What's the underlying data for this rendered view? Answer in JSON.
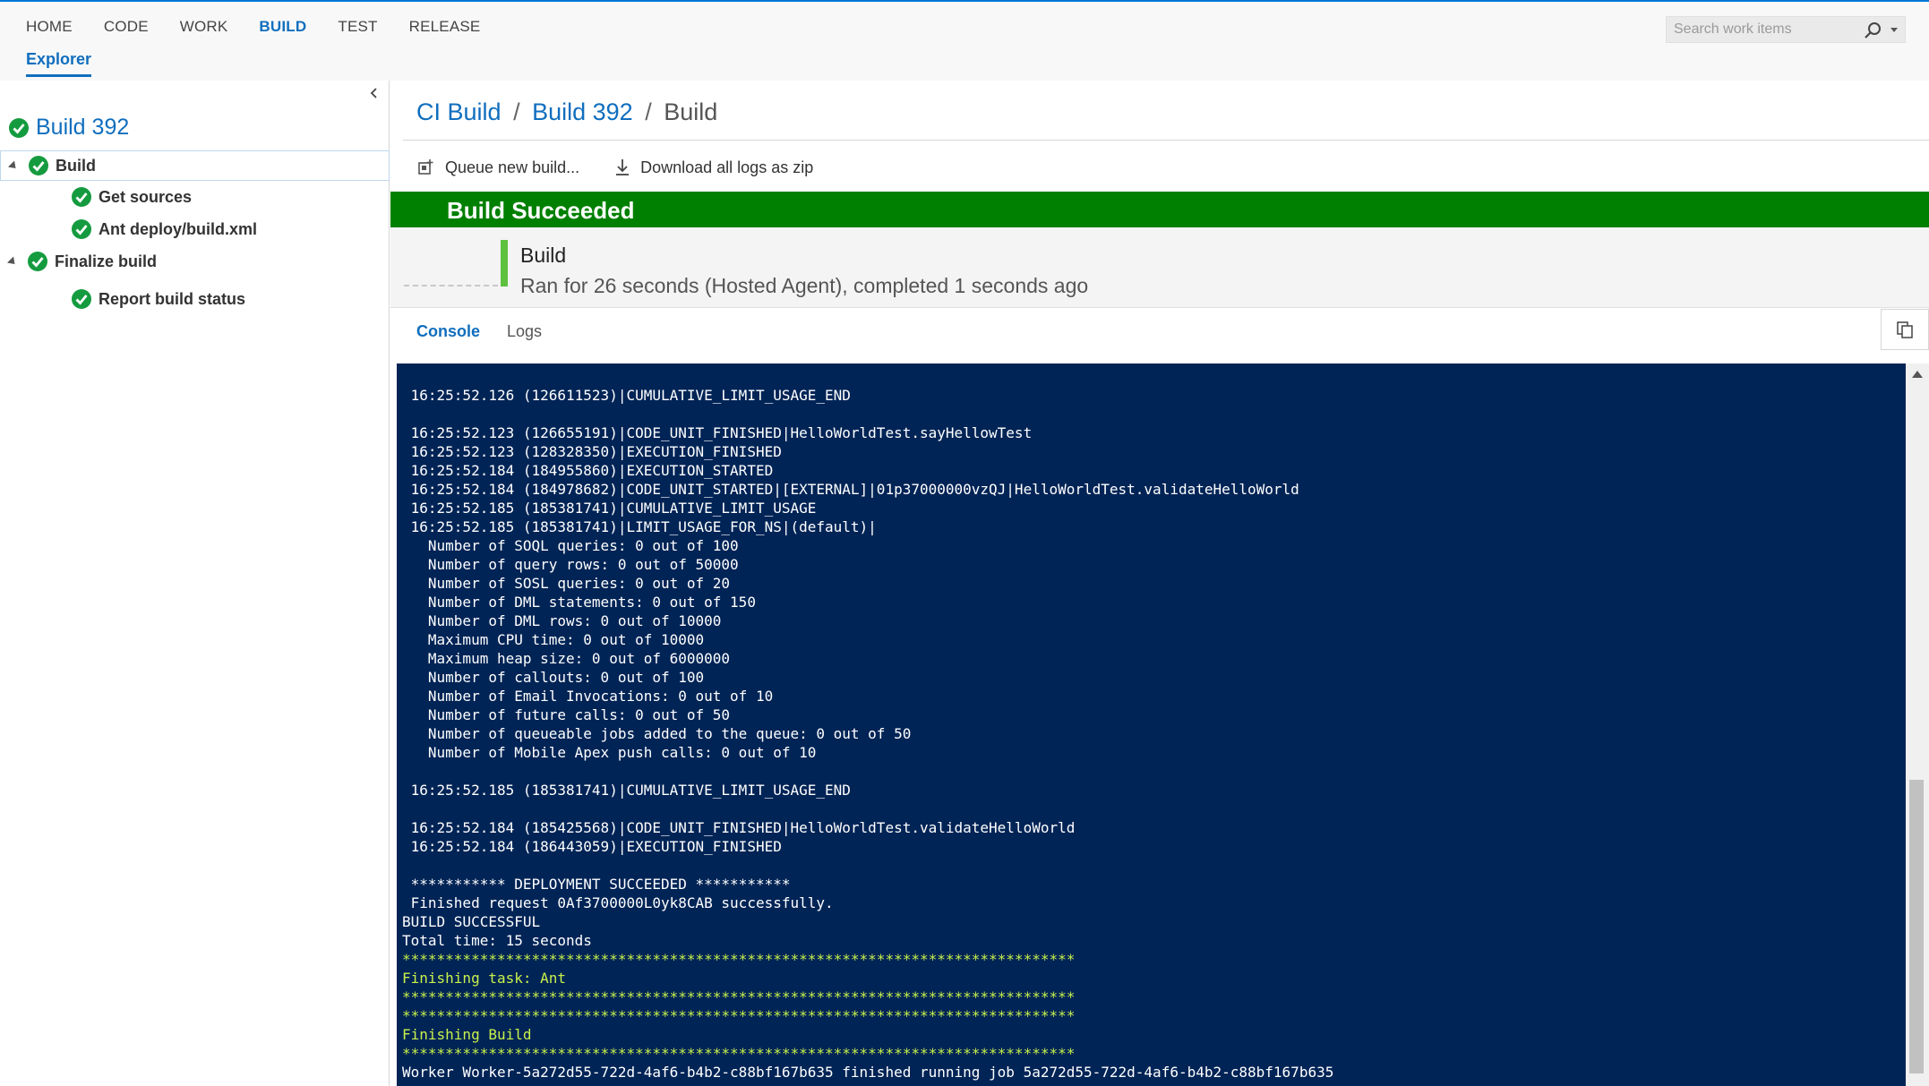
{
  "topnav": {
    "items": [
      "HOME",
      "CODE",
      "WORK",
      "BUILD",
      "TEST",
      "RELEASE"
    ],
    "active": "BUILD",
    "subnav": "Explorer",
    "search_placeholder": "Search work items"
  },
  "explorer": {
    "title": "Build 392",
    "tree": [
      {
        "label": "Build",
        "status": "succeeded",
        "expanded": true,
        "selected": true
      },
      {
        "label": "Get sources",
        "status": "succeeded"
      },
      {
        "label": "Ant deploy/build.xml",
        "status": "succeeded"
      },
      {
        "label": "Finalize build",
        "status": "succeeded",
        "expanded": true
      },
      {
        "label": "Report build status",
        "status": "succeeded"
      }
    ]
  },
  "breadcrumb": {
    "parts": [
      "CI Build",
      "Build 392",
      "Build"
    ],
    "separator": "/"
  },
  "toolbar": {
    "queue_label": "Queue new build...",
    "download_label": "Download all logs as zip"
  },
  "banner": {
    "text": "Build Succeeded",
    "color": "#008000"
  },
  "summary": {
    "title": "Build",
    "detail": "Ran for 26 seconds (Hosted Agent), completed 1 seconds ago"
  },
  "tabs": {
    "items": [
      "Console",
      "Logs"
    ],
    "active": "Console"
  },
  "console": {
    "background": "#012456",
    "lines": [
      {
        "text": "",
        "style": "white"
      },
      {
        "text": " 16:25:52.126 (126611523)|CUMULATIVE_LIMIT_USAGE_END",
        "style": "white"
      },
      {
        "text": "",
        "style": "white"
      },
      {
        "text": " 16:25:52.123 (126655191)|CODE_UNIT_FINISHED|HelloWorldTest.sayHellowTest",
        "style": "white"
      },
      {
        "text": " 16:25:52.123 (128328350)|EXECUTION_FINISHED",
        "style": "white"
      },
      {
        "text": " 16:25:52.184 (184955860)|EXECUTION_STARTED",
        "style": "white"
      },
      {
        "text": " 16:25:52.184 (184978682)|CODE_UNIT_STARTED|[EXTERNAL]|01p37000000vzQJ|HelloWorldTest.validateHelloWorld",
        "style": "white"
      },
      {
        "text": " 16:25:52.185 (185381741)|CUMULATIVE_LIMIT_USAGE",
        "style": "white"
      },
      {
        "text": " 16:25:52.185 (185381741)|LIMIT_USAGE_FOR_NS|(default)|",
        "style": "white"
      },
      {
        "text": "   Number of SOQL queries: 0 out of 100",
        "style": "white"
      },
      {
        "text": "   Number of query rows: 0 out of 50000",
        "style": "white"
      },
      {
        "text": "   Number of SOSL queries: 0 out of 20",
        "style": "white"
      },
      {
        "text": "   Number of DML statements: 0 out of 150",
        "style": "white"
      },
      {
        "text": "   Number of DML rows: 0 out of 10000",
        "style": "white"
      },
      {
        "text": "   Maximum CPU time: 0 out of 10000",
        "style": "white"
      },
      {
        "text": "   Maximum heap size: 0 out of 6000000",
        "style": "white"
      },
      {
        "text": "   Number of callouts: 0 out of 100",
        "style": "white"
      },
      {
        "text": "   Number of Email Invocations: 0 out of 10",
        "style": "white"
      },
      {
        "text": "   Number of future calls: 0 out of 50",
        "style": "white"
      },
      {
        "text": "   Number of queueable jobs added to the queue: 0 out of 50",
        "style": "white"
      },
      {
        "text": "   Number of Mobile Apex push calls: 0 out of 10",
        "style": "white"
      },
      {
        "text": "",
        "style": "white"
      },
      {
        "text": " 16:25:52.185 (185381741)|CUMULATIVE_LIMIT_USAGE_END",
        "style": "white"
      },
      {
        "text": "",
        "style": "white"
      },
      {
        "text": " 16:25:52.184 (185425568)|CODE_UNIT_FINISHED|HelloWorldTest.validateHelloWorld",
        "style": "white"
      },
      {
        "text": " 16:25:52.184 (186443059)|EXECUTION_FINISHED",
        "style": "white"
      },
      {
        "text": "",
        "style": "white"
      },
      {
        "text": " *********** DEPLOYMENT SUCCEEDED ***********",
        "style": "white"
      },
      {
        "text": " Finished request 0Af3700000L0yk8CAB successfully.",
        "style": "white"
      },
      {
        "text": "BUILD SUCCESSFUL",
        "style": "white"
      },
      {
        "text": "Total time: 15 seconds",
        "style": "white"
      },
      {
        "text": "******************************************************************************",
        "style": "green"
      },
      {
        "text": "Finishing task: Ant",
        "style": "green"
      },
      {
        "text": "******************************************************************************",
        "style": "green"
      },
      {
        "text": "******************************************************************************",
        "style": "green"
      },
      {
        "text": "Finishing Build",
        "style": "green"
      },
      {
        "text": "******************************************************************************",
        "style": "green"
      },
      {
        "text": "Worker Worker-5a272d55-722d-4af6-b4b2-c88bf167b635 finished running job 5a272d55-722d-4af6-b4b2-c88bf167b635",
        "style": "white"
      }
    ]
  }
}
